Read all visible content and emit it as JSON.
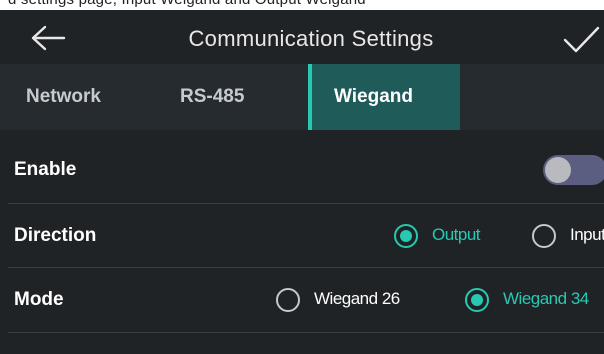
{
  "top_strip": {
    "text": "d settings page, Input Weigand and Output Weigand"
  },
  "header": {
    "title": "Communication Settings",
    "back_icon": "arrow-left-icon",
    "confirm_icon": "checkmark-icon"
  },
  "tabs": [
    {
      "label": "Network",
      "active": false
    },
    {
      "label": "RS-485",
      "active": false
    },
    {
      "label": "Wiegand",
      "active": true
    }
  ],
  "settings": {
    "enable": {
      "label": "Enable",
      "on": false
    },
    "direction": {
      "label": "Direction",
      "options": [
        {
          "label": "Output",
          "selected": true
        },
        {
          "label": "Input",
          "selected": false
        }
      ]
    },
    "mode": {
      "label": "Mode",
      "options": [
        {
          "label": "Wiegand 26",
          "selected": false
        },
        {
          "label": "Wiegand 34",
          "selected": true
        }
      ]
    }
  },
  "colors": {
    "background": "#1f2326",
    "tab_bar": "#262b30",
    "active_tab": "#1f5b58",
    "accent": "#27c9b3",
    "toggle_track": "#5b5e80"
  }
}
